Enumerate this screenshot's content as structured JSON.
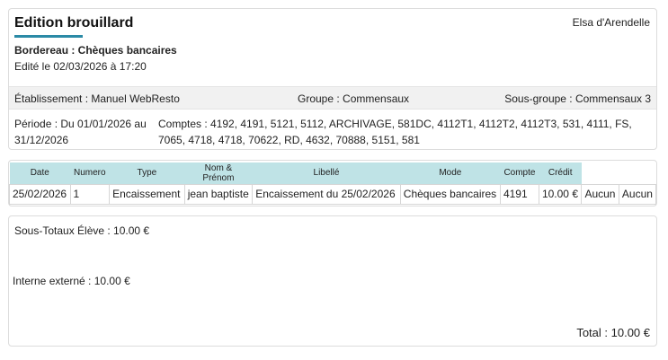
{
  "header": {
    "title": "Edition brouillard",
    "user": "Elsa d'Arendelle",
    "subtitle": "Bordereau : Chèques bancaires",
    "edited": "Edité le 02/03/2026 à 17:20"
  },
  "info": {
    "etablissement": "Établissement : Manuel WebResto",
    "groupe": "Groupe : Commensaux",
    "sous_groupe": "Sous-groupe : Commensaux 3",
    "periode": "Période : Du 01/01/2026 au 31/12/2026",
    "comptes": "Comptes : 4192, 4191, 5121, 5112, ARCHIVAGE, 581DC, 4112T1, 4112T2, 4112T3, 531, 4111, FS, 7065, 4718, 4718, 70622, RD, 4632, 70888, 5151, 581"
  },
  "table": {
    "headers": [
      "Date",
      "Numero",
      "Type",
      "Nom & Prénom",
      "Libellé",
      "Mode",
      "Compte",
      "Crédit"
    ],
    "rows": [
      [
        "25/02/2026",
        "1",
        "Encaissement",
        "jean baptiste",
        "Encaissement du 25/02/2026",
        "Chèques bancaires",
        "4191",
        "10.00 €",
        "Aucun",
        "Aucun"
      ]
    ]
  },
  "totals": {
    "sous_totaux": "Sous-Totaux Élève : 10.00 €",
    "interne": "Interne externé : 10.00 €",
    "total": "Total : 10.00 €"
  },
  "colors": {
    "accent": "#2b8aa6",
    "table_header_bg": "#bfe3e6",
    "band_bg": "#f1f1f1"
  }
}
